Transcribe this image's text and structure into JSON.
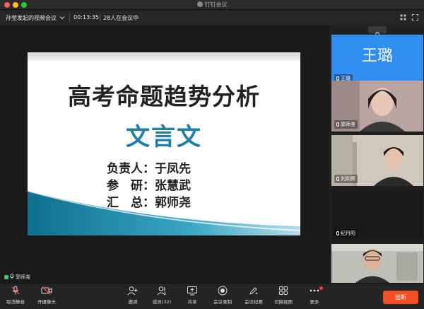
{
  "window": {
    "title": "钉钉会议"
  },
  "header": {
    "meeting_name": "孙莹发起的视频会议",
    "timer": "00:13:35",
    "participants_text": "28人在会议中"
  },
  "slide": {
    "title": "高考命题趋势分析",
    "subtitle": "文言文",
    "credits": [
      "负责人：于凤先",
      "参　研：张慧武",
      "汇　总：郭师尧"
    ]
  },
  "speaker": {
    "name": "郭师尧"
  },
  "participants": [
    {
      "name": "王璐",
      "avatar_text": "王璐"
    },
    {
      "name": "郭师尧"
    },
    {
      "name": "刘利辉"
    },
    {
      "name": "纪丹阳"
    }
  ],
  "toolbar": {
    "mute_label": "取消静音",
    "camera_label": "开摄像头",
    "invite_label": "邀请",
    "members_label": "成员(32)",
    "share_label": "共享",
    "record_label": "会议录制",
    "minutes_label": "会议纪要",
    "view_label": "切换视图",
    "more_label": "更多",
    "end_label": "挂断"
  },
  "colors": {
    "end_button": "#f25024",
    "avatar_bg": "#2f8ef0",
    "subtitle": "#1f7fa8",
    "mic_active": "#3ec26b"
  }
}
